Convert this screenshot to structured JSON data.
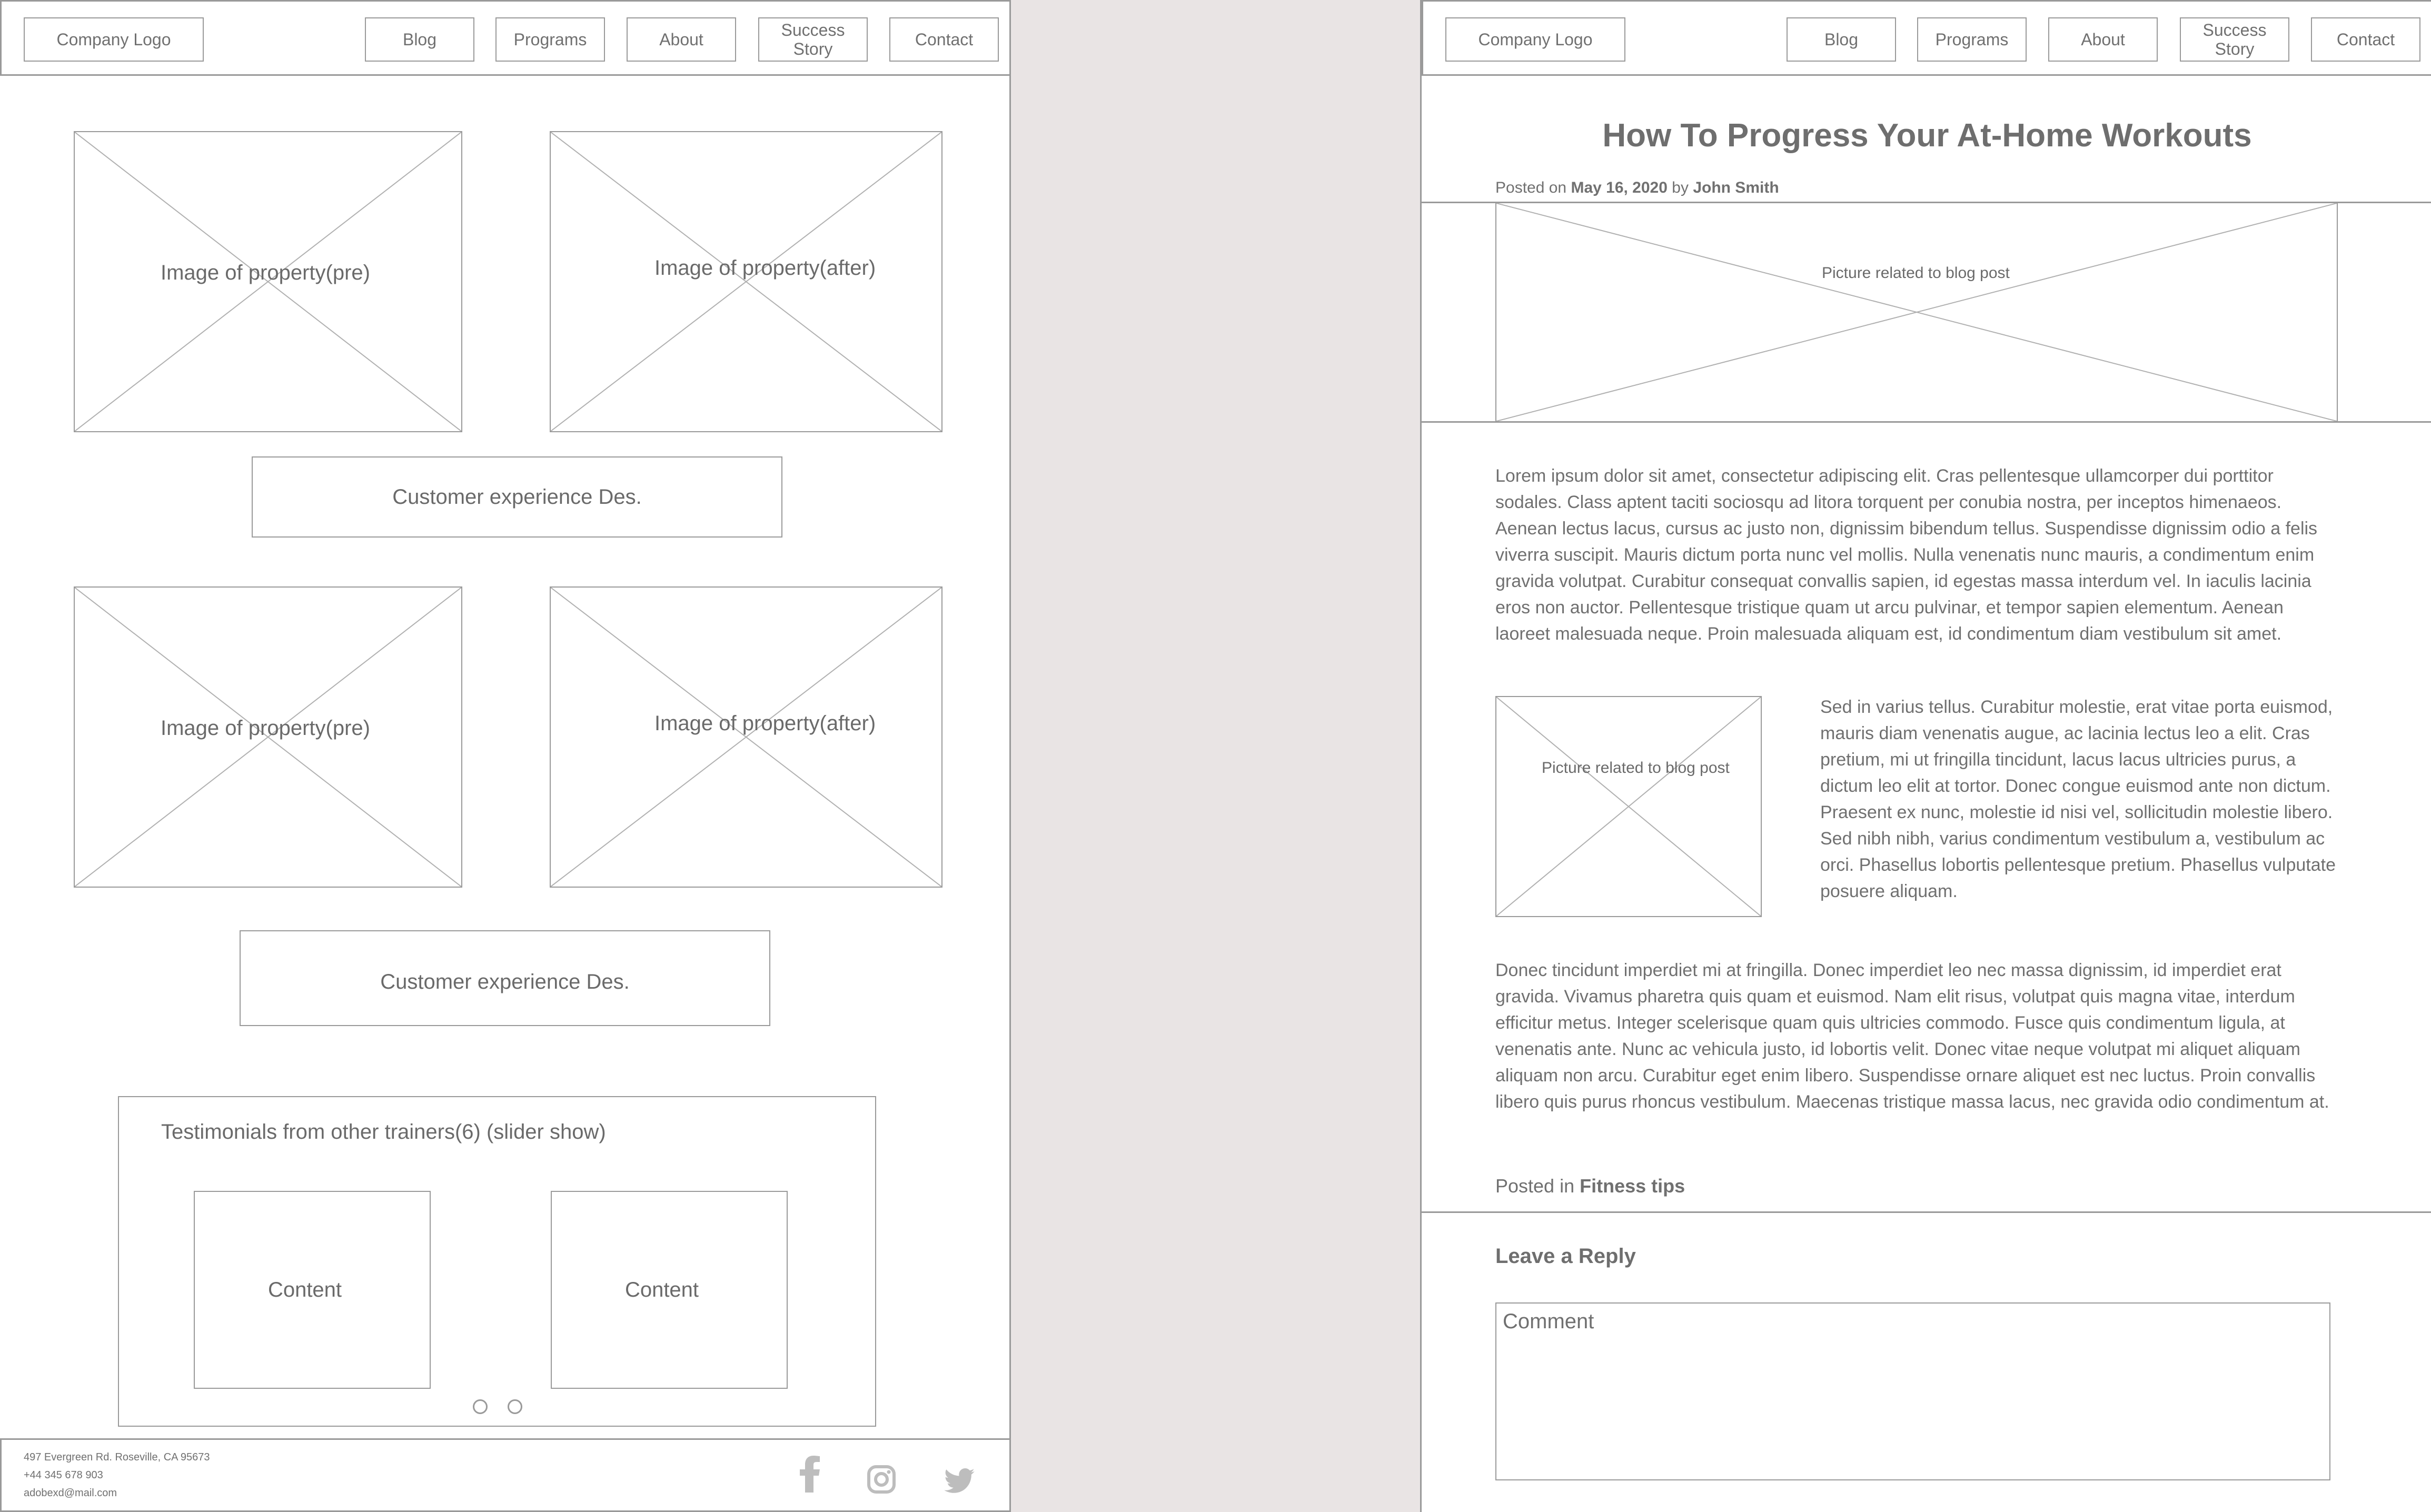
{
  "nav": {
    "logo": "Company Logo",
    "blog": "Blog",
    "programs": "Programs",
    "about": "About",
    "success_story": "Success\nStory",
    "contact": "Contact"
  },
  "left": {
    "images": [
      "Image of property(pre)",
      "Image of property(after)",
      "Image of property(pre)",
      "Image of property(after)"
    ],
    "experience_1": "Customer experience Des.",
    "experience_2": "Customer experience Des.",
    "testimonials": {
      "title": "Testimonials from other trainers(6) (slider show)",
      "cards": [
        "Content",
        "Content"
      ]
    },
    "footer": {
      "address": "497 Evergreen Rd. Roseville, CA 95673",
      "phone": "+44 345 678 903",
      "email": "adobexd@mail.com",
      "social_icons": [
        "facebook-icon",
        "instagram-icon",
        "twitter-icon"
      ]
    }
  },
  "right": {
    "title": "How To Progress Your At-Home Workouts",
    "meta": {
      "posted_on": "Posted on",
      "date": "May 16, 2020",
      "by": "by",
      "author": "John Smith"
    },
    "hero_image_label": "Picture related to blog post",
    "para1": "Lorem ipsum dolor sit amet, consectetur adipiscing elit. Cras pellentesque ullamcorper dui porttitor sodales. Class aptent taciti sociosqu ad litora torquent per conubia nostra, per inceptos himenaeos. Aenean lectus lacus, cursus ac justo non, dignissim bibendum tellus. Suspendisse dignissim odio a felis viverra suscipit. Mauris dictum porta nunc vel mollis. Nulla venenatis nunc mauris, a condimentum enim gravida volutpat. Curabitur consequat convallis sapien, id egestas massa interdum vel. In iaculis lacinia eros non auctor. Pellentesque tristique quam ut arcu pulvinar, et tempor sapien elementum. Aenean laoreet malesuada neque. Proin malesuada aliquam est, id condimentum diam vestibulum sit amet.",
    "inline_image_label": "Picture related to blog post",
    "para2": "Sed in varius tellus. Curabitur molestie, erat vitae porta euismod, mauris diam venenatis augue, ac lacinia lectus leo a elit. Cras pretium, mi ut fringilla tincidunt, lacus lacus ultricies purus, a dictum leo elit at tortor. Donec congue euismod ante non dictum. Praesent ex nunc, molestie id nisi vel, sollicitudin molestie libero. Sed nibh nibh, varius condimentum vestibulum a, vestibulum ac orci. Phasellus lobortis pellentesque pretium. Phasellus vulputate posuere aliquam.",
    "para3": "Donec tincidunt imperdiet mi at fringilla. Donec imperdiet leo nec massa dignissim, id imperdiet erat gravida. Vivamus pharetra quis quam et euismod. Nam elit risus, volutpat quis magna vitae, interdum efficitur metus. Integer scelerisque quam quis ultricies commodo. Fusce quis condimentum ligula, at venenatis ante. Nunc ac vehicula justo, id lobortis velit. Donec vitae neque volutpat mi aliquet aliquam aliquam non arcu. Curabitur eget enim libero. Suspendisse ornare aliquet est nec luctus. Proin convallis libero quis purus rhoncus vestibulum. Maecenas tristique massa lacus, nec gravida odio condimentum at.",
    "posted_in_label": "Posted in",
    "category": "Fitness tips",
    "reply_heading": "Leave a Reply",
    "comment_placeholder": "Comment"
  }
}
